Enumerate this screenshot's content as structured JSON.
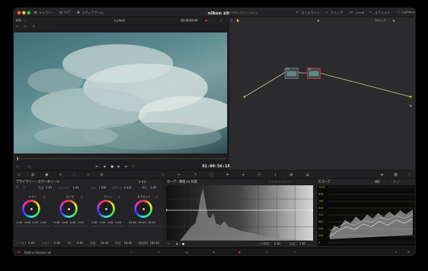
{
  "topbar": {
    "items": [
      "ギャラリー",
      "LUT",
      "メディアプール"
    ],
    "title": "nikon z9",
    "unsaved": "変更が保存されていません",
    "right_items": [
      "タイムライン",
      "クリップ",
      "ノード",
      "エフェクト",
      "Lightbox"
    ]
  },
  "viewer": {
    "zoom": "30%",
    "clip_name": "x_cloud",
    "source_tc": "00:00:00:00",
    "timecode": "01:00:56:18"
  },
  "nodes": {
    "mode": "クリップ",
    "node1": "01",
    "node2": "02"
  },
  "primaries": {
    "title": "プライマリー - カラーホイール",
    "top_labels": [
      {
        "label": "色温",
        "value": "0.00"
      },
      {
        "label": "ティント",
        "value": "0.00"
      },
      {
        "label": "コン",
        "value": "1.000"
      },
      {
        "label": "ピボット",
        "value": "0.435"
      },
      {
        "label": "MD",
        "value": "0.00"
      }
    ],
    "wheels": [
      {
        "label": "リフト",
        "vals": [
          "0.00",
          "0.00",
          "0.00",
          "0.00"
        ]
      },
      {
        "label": "ガンマ",
        "vals": [
          "0.00",
          "0.00",
          "0.00",
          "0.00"
        ]
      },
      {
        "label": "ゲイン",
        "vals": [
          "1.00",
          "1.00",
          "1.00",
          "1.00"
        ]
      },
      {
        "label": "オフセット",
        "vals": [
          "25.00",
          "25.00",
          "25.00"
        ]
      }
    ],
    "bottom_labels": [
      {
        "label": "ブースト",
        "value": "0.00"
      },
      {
        "label": "シャド",
        "value": "0.00"
      },
      {
        "label": "HL",
        "value": "0.00"
      },
      {
        "label": "彩度",
        "value": "50.00"
      },
      {
        "label": "色相",
        "value": "50.00"
      },
      {
        "label": "輝度MX",
        "value": "100.00"
      }
    ]
  },
  "curves": {
    "title": "カーブ - 輝度 vs 彩度",
    "input_label": "入力輝度",
    "input_value": "0.00",
    "sat_label": "彩度",
    "sat_value": "1.00"
  },
  "scope": {
    "title": "スコープ",
    "mode": "波形",
    "ticks": [
      "1023",
      "896",
      "768",
      "640",
      "512",
      "384",
      "256",
      "128",
      "0"
    ]
  },
  "footer": {
    "app": "DaVinci Resolve 18"
  },
  "colors": {
    "accent": "#e0583a",
    "node_line": "#d8d8a0",
    "bg": "#1c1c1e"
  }
}
